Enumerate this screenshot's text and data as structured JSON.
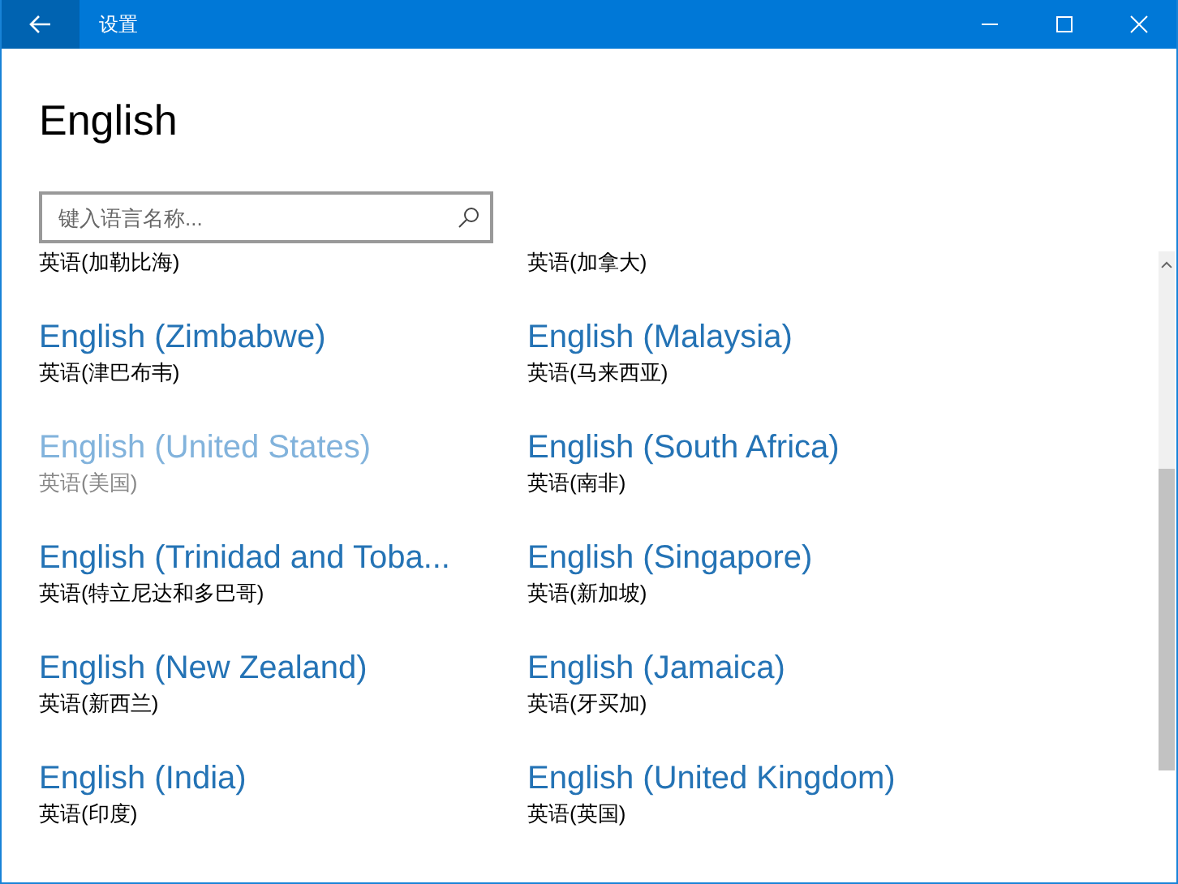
{
  "window": {
    "title": "设置"
  },
  "heading": "English",
  "search": {
    "placeholder": "键入语言名称..."
  },
  "partial_row": [
    "英语(加勒比海)",
    "英语(加拿大)"
  ],
  "languages": [
    {
      "name": "English (Zimbabwe)",
      "native": "英语(津巴布韦)",
      "disabled": false
    },
    {
      "name": "English (Malaysia)",
      "native": "英语(马来西亚)",
      "disabled": false
    },
    {
      "name": "English (United States)",
      "native": "英语(美国)",
      "disabled": true
    },
    {
      "name": "English (South Africa)",
      "native": "英语(南非)",
      "disabled": false
    },
    {
      "name": "English (Trinidad and Toba...",
      "native": "英语(特立尼达和多巴哥)",
      "disabled": false
    },
    {
      "name": "English (Singapore)",
      "native": "英语(新加坡)",
      "disabled": false
    },
    {
      "name": "English (New Zealand)",
      "native": "英语(新西兰)",
      "disabled": false
    },
    {
      "name": "English (Jamaica)",
      "native": "英语(牙买加)",
      "disabled": false
    },
    {
      "name": "English (India)",
      "native": "英语(印度)",
      "disabled": false
    },
    {
      "name": "English (United Kingdom)",
      "native": "英语(英国)",
      "disabled": false
    }
  ]
}
